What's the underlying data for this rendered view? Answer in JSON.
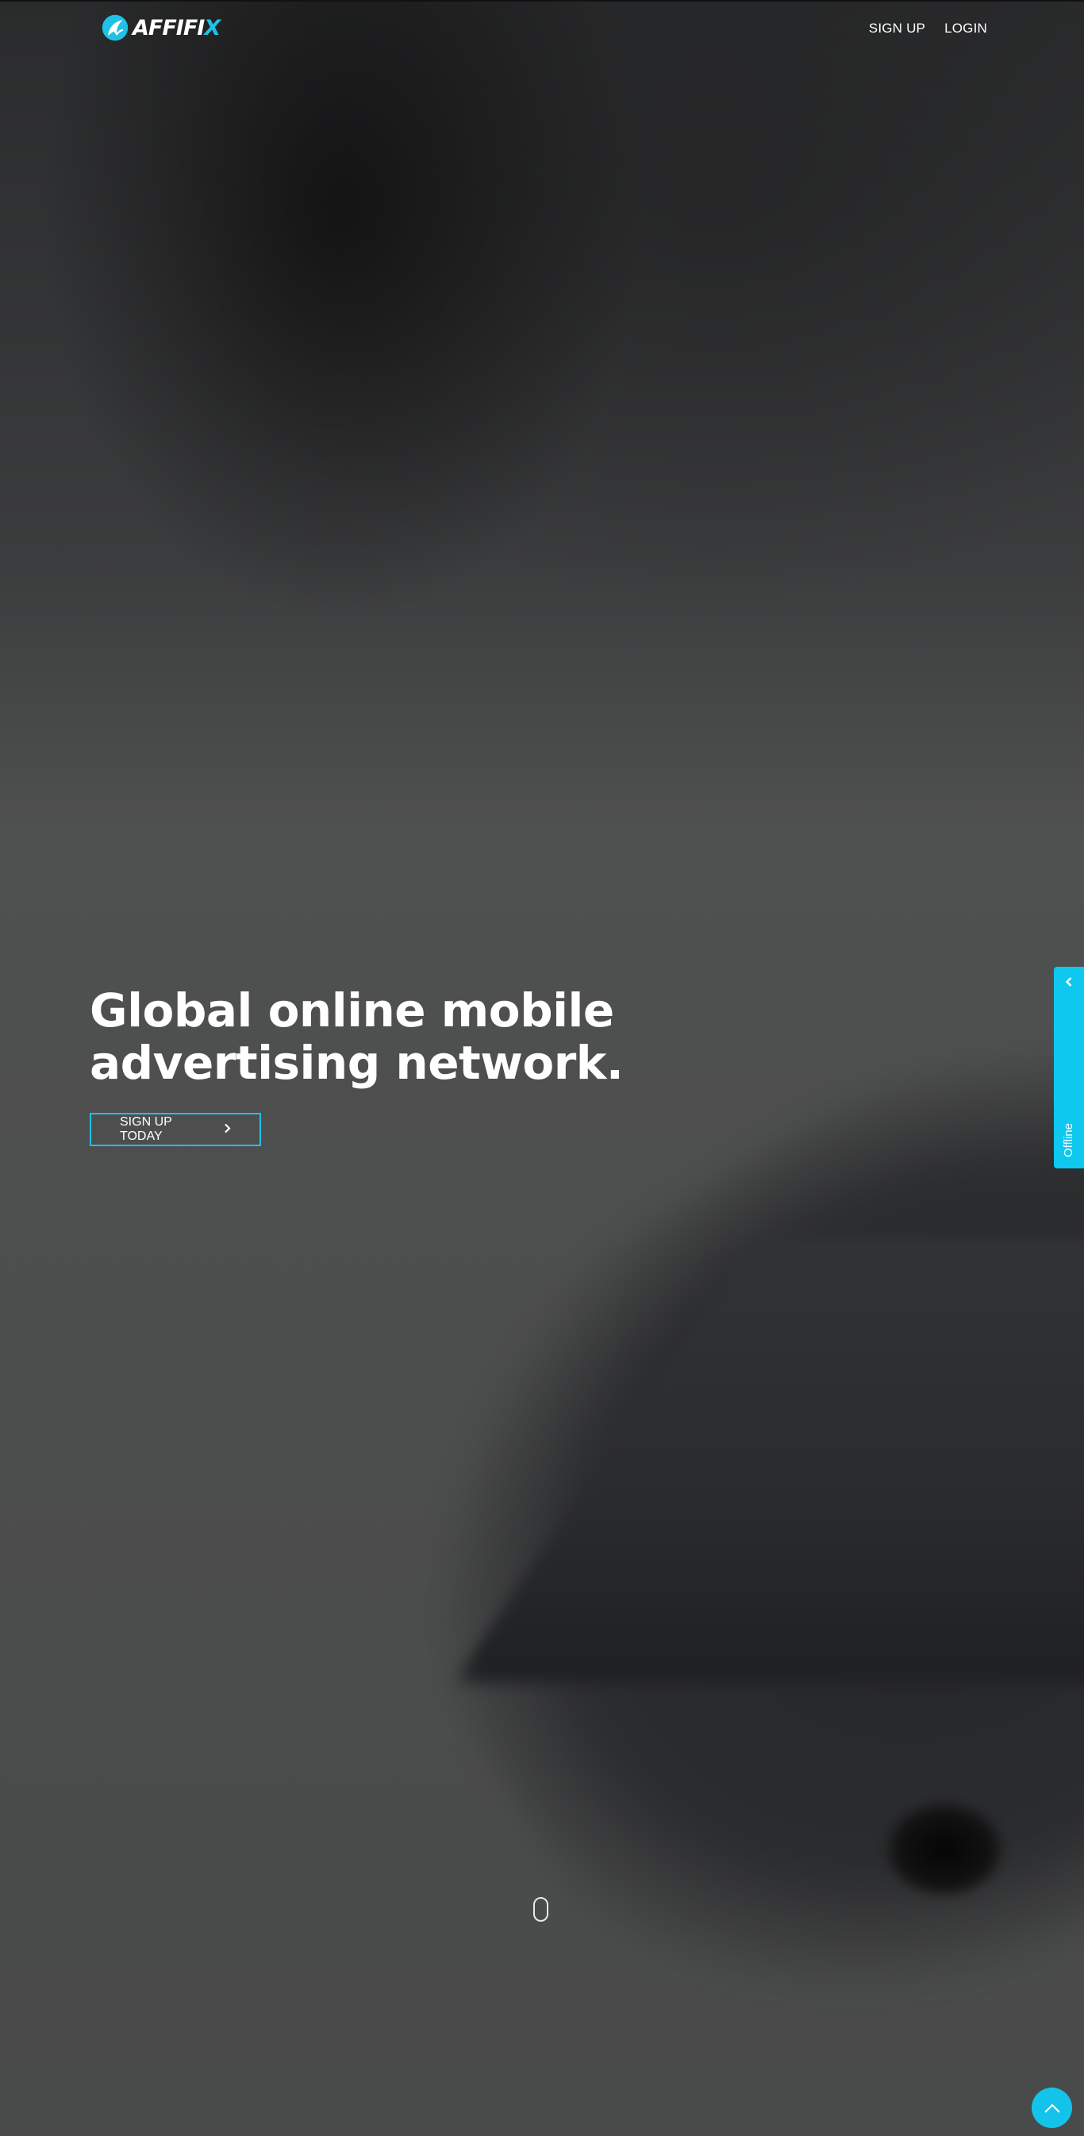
{
  "brand": {
    "logo_prefix": "AFFIFI",
    "logo_suffix": "X",
    "accent_color": "#1fc1e6"
  },
  "nav": {
    "items": [
      {
        "label": "SIGN UP"
      },
      {
        "label": "LOGIN"
      }
    ]
  },
  "hero": {
    "title_line1": "Global online mobile",
    "title_line2": "advertising network.",
    "cta_label": "SIGN UP TODAY",
    "cta_icon": "chevron-right-icon"
  },
  "chat_widget": {
    "status": "Offline",
    "toggle_icon": "chevron-left-icon",
    "color": "#0ec8ef"
  },
  "scroll_indicator": {
    "icon": "mouse-icon"
  },
  "back_to_top": {
    "icon": "chevron-up-icon",
    "color": "#14c3ea"
  }
}
